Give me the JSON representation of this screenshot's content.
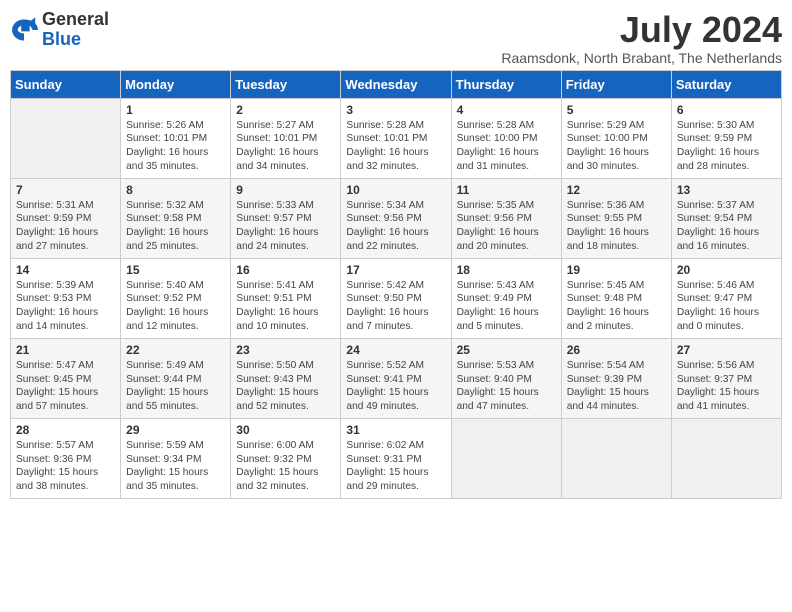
{
  "header": {
    "logo_general": "General",
    "logo_blue": "Blue",
    "month_title": "July 2024",
    "location": "Raamsdonk, North Brabant, The Netherlands"
  },
  "days_of_week": [
    "Sunday",
    "Monday",
    "Tuesday",
    "Wednesday",
    "Thursday",
    "Friday",
    "Saturday"
  ],
  "weeks": [
    [
      {
        "day": "",
        "info": ""
      },
      {
        "day": "1",
        "info": "Sunrise: 5:26 AM\nSunset: 10:01 PM\nDaylight: 16 hours\nand 35 minutes."
      },
      {
        "day": "2",
        "info": "Sunrise: 5:27 AM\nSunset: 10:01 PM\nDaylight: 16 hours\nand 34 minutes."
      },
      {
        "day": "3",
        "info": "Sunrise: 5:28 AM\nSunset: 10:01 PM\nDaylight: 16 hours\nand 32 minutes."
      },
      {
        "day": "4",
        "info": "Sunrise: 5:28 AM\nSunset: 10:00 PM\nDaylight: 16 hours\nand 31 minutes."
      },
      {
        "day": "5",
        "info": "Sunrise: 5:29 AM\nSunset: 10:00 PM\nDaylight: 16 hours\nand 30 minutes."
      },
      {
        "day": "6",
        "info": "Sunrise: 5:30 AM\nSunset: 9:59 PM\nDaylight: 16 hours\nand 28 minutes."
      }
    ],
    [
      {
        "day": "7",
        "info": "Sunrise: 5:31 AM\nSunset: 9:59 PM\nDaylight: 16 hours\nand 27 minutes."
      },
      {
        "day": "8",
        "info": "Sunrise: 5:32 AM\nSunset: 9:58 PM\nDaylight: 16 hours\nand 25 minutes."
      },
      {
        "day": "9",
        "info": "Sunrise: 5:33 AM\nSunset: 9:57 PM\nDaylight: 16 hours\nand 24 minutes."
      },
      {
        "day": "10",
        "info": "Sunrise: 5:34 AM\nSunset: 9:56 PM\nDaylight: 16 hours\nand 22 minutes."
      },
      {
        "day": "11",
        "info": "Sunrise: 5:35 AM\nSunset: 9:56 PM\nDaylight: 16 hours\nand 20 minutes."
      },
      {
        "day": "12",
        "info": "Sunrise: 5:36 AM\nSunset: 9:55 PM\nDaylight: 16 hours\nand 18 minutes."
      },
      {
        "day": "13",
        "info": "Sunrise: 5:37 AM\nSunset: 9:54 PM\nDaylight: 16 hours\nand 16 minutes."
      }
    ],
    [
      {
        "day": "14",
        "info": "Sunrise: 5:39 AM\nSunset: 9:53 PM\nDaylight: 16 hours\nand 14 minutes."
      },
      {
        "day": "15",
        "info": "Sunrise: 5:40 AM\nSunset: 9:52 PM\nDaylight: 16 hours\nand 12 minutes."
      },
      {
        "day": "16",
        "info": "Sunrise: 5:41 AM\nSunset: 9:51 PM\nDaylight: 16 hours\nand 10 minutes."
      },
      {
        "day": "17",
        "info": "Sunrise: 5:42 AM\nSunset: 9:50 PM\nDaylight: 16 hours\nand 7 minutes."
      },
      {
        "day": "18",
        "info": "Sunrise: 5:43 AM\nSunset: 9:49 PM\nDaylight: 16 hours\nand 5 minutes."
      },
      {
        "day": "19",
        "info": "Sunrise: 5:45 AM\nSunset: 9:48 PM\nDaylight: 16 hours\nand 2 minutes."
      },
      {
        "day": "20",
        "info": "Sunrise: 5:46 AM\nSunset: 9:47 PM\nDaylight: 16 hours\nand 0 minutes."
      }
    ],
    [
      {
        "day": "21",
        "info": "Sunrise: 5:47 AM\nSunset: 9:45 PM\nDaylight: 15 hours\nand 57 minutes."
      },
      {
        "day": "22",
        "info": "Sunrise: 5:49 AM\nSunset: 9:44 PM\nDaylight: 15 hours\nand 55 minutes."
      },
      {
        "day": "23",
        "info": "Sunrise: 5:50 AM\nSunset: 9:43 PM\nDaylight: 15 hours\nand 52 minutes."
      },
      {
        "day": "24",
        "info": "Sunrise: 5:52 AM\nSunset: 9:41 PM\nDaylight: 15 hours\nand 49 minutes."
      },
      {
        "day": "25",
        "info": "Sunrise: 5:53 AM\nSunset: 9:40 PM\nDaylight: 15 hours\nand 47 minutes."
      },
      {
        "day": "26",
        "info": "Sunrise: 5:54 AM\nSunset: 9:39 PM\nDaylight: 15 hours\nand 44 minutes."
      },
      {
        "day": "27",
        "info": "Sunrise: 5:56 AM\nSunset: 9:37 PM\nDaylight: 15 hours\nand 41 minutes."
      }
    ],
    [
      {
        "day": "28",
        "info": "Sunrise: 5:57 AM\nSunset: 9:36 PM\nDaylight: 15 hours\nand 38 minutes."
      },
      {
        "day": "29",
        "info": "Sunrise: 5:59 AM\nSunset: 9:34 PM\nDaylight: 15 hours\nand 35 minutes."
      },
      {
        "day": "30",
        "info": "Sunrise: 6:00 AM\nSunset: 9:32 PM\nDaylight: 15 hours\nand 32 minutes."
      },
      {
        "day": "31",
        "info": "Sunrise: 6:02 AM\nSunset: 9:31 PM\nDaylight: 15 hours\nand 29 minutes."
      },
      {
        "day": "",
        "info": ""
      },
      {
        "day": "",
        "info": ""
      },
      {
        "day": "",
        "info": ""
      }
    ]
  ]
}
